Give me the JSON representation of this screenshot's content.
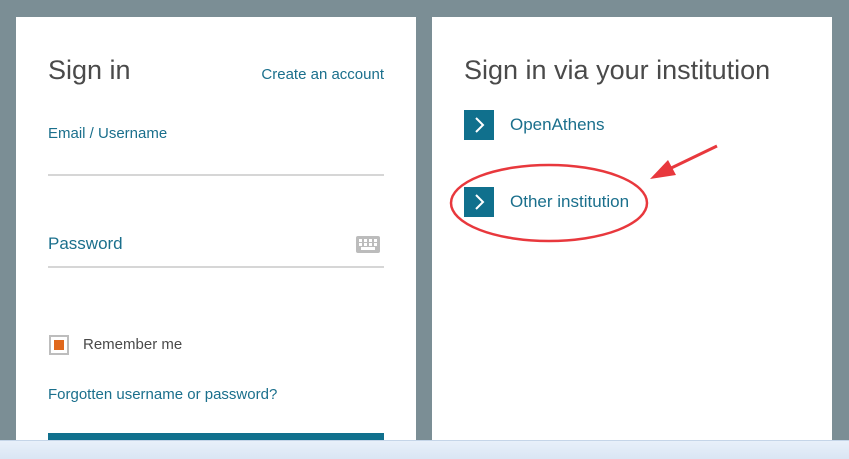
{
  "signin": {
    "title": "Sign in",
    "create_account_link": "Create an account",
    "email_label": "Email / Username",
    "email_value": "",
    "password_label": "Password",
    "password_value": "",
    "remember_label": "Remember me",
    "remember_checked": true,
    "forgot_link": "Forgotten username or password?"
  },
  "institution": {
    "title": "Sign in via your institution",
    "options": [
      {
        "label": "OpenAthens"
      },
      {
        "label": "Other institution"
      }
    ]
  },
  "icons": {
    "keyboard": "keyboard-icon",
    "chevron": "chevron-right-icon"
  },
  "colors": {
    "background": "#7b8e95",
    "accent": "#10708d",
    "link": "#1a6f8c",
    "checkbox_fill": "#e0681c",
    "annotation": "#e8383d"
  }
}
